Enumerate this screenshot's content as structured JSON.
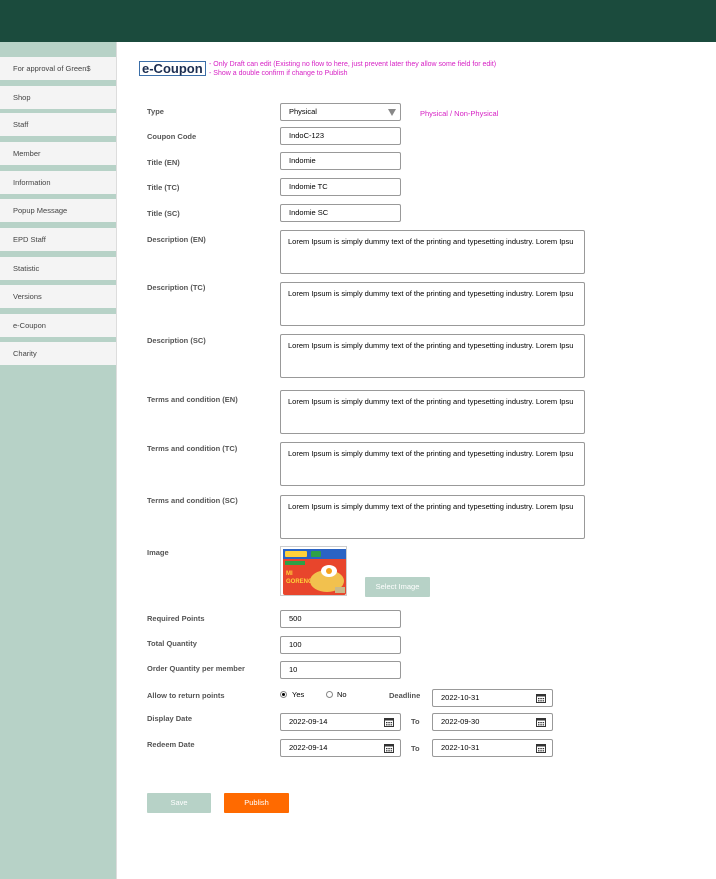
{
  "sidebar": {
    "items": [
      {
        "label": "For approval of Green$"
      },
      {
        "label": "Shop"
      },
      {
        "label": "Staff"
      },
      {
        "label": "Member"
      },
      {
        "label": "Information"
      },
      {
        "label": "Popup Message"
      },
      {
        "label": "EPD Staff"
      },
      {
        "label": "Statistic"
      },
      {
        "label": "Versions"
      },
      {
        "label": "e-Coupon"
      },
      {
        "label": "Charity"
      }
    ]
  },
  "page": {
    "title": "e-Coupon",
    "note_1": "- Only Draft can edit (Existing no flow to here, just prevent later they allow some field for edit)",
    "note_2": "- Show a double confirm if change to Publish"
  },
  "form": {
    "type": {
      "label": "Type",
      "value": "Physical",
      "hint": "Physical / Non-Physical"
    },
    "coupon_code": {
      "label": "Coupon Code",
      "value": "IndoC-123"
    },
    "title_en": {
      "label": "Title (EN)",
      "value": "Indomie"
    },
    "title_tc": {
      "label": "Title (TC)",
      "value": "Indomie TC"
    },
    "title_sc": {
      "label": "Title (SC)",
      "value": "Indomie SC"
    },
    "desc_en": {
      "label": "Description (EN)",
      "value": "Lorem Ipsum is simply dummy text of the printing and typesetting industry. Lorem Ipsu"
    },
    "desc_tc": {
      "label": "Description (TC)",
      "value": "Lorem Ipsum is simply dummy text of the printing and typesetting industry. Lorem Ipsu"
    },
    "desc_sc": {
      "label": "Description (SC)",
      "value": "Lorem Ipsum is simply dummy text of the printing and typesetting industry. Lorem Ipsu"
    },
    "terms_en": {
      "label": "Terms and condition (EN)",
      "value": "Lorem Ipsum is simply dummy text of the printing and typesetting industry. Lorem Ipsu"
    },
    "terms_tc": {
      "label": "Terms and condition (TC)",
      "value": "Lorem Ipsum is simply dummy text of the printing and typesetting industry. Lorem Ipsu"
    },
    "terms_sc": {
      "label": "Terms and condition (SC)",
      "value": "Lorem Ipsum is simply dummy text of the printing and typesetting industry. Lorem Ipsu"
    },
    "image": {
      "label": "Image",
      "select_label": "Select Image"
    },
    "required_points": {
      "label": "Required Points",
      "value": "500"
    },
    "total_quantity": {
      "label": "Total Quantity",
      "value": "100"
    },
    "order_qty": {
      "label": "Order Quantity per member",
      "value": "10"
    },
    "allow_return": {
      "label": "Allow to return points",
      "yes_label": "Yes",
      "no_label": "No",
      "selected": "Yes",
      "deadline_label": "Deadline",
      "deadline_value": "2022-10-31"
    },
    "display_date": {
      "label": "Display Date",
      "from": "2022-09-14",
      "to_label": "To",
      "to": "2022-09-30"
    },
    "redeem_date": {
      "label": "Redeem Date",
      "from": "2022-09-14",
      "to_label": "To",
      "to": "2022-10-31"
    }
  },
  "buttons": {
    "save_label": "Save",
    "publish_label": "Publish"
  },
  "colors": {
    "topbar": "#1b4b3d",
    "sidebar": "#b7d2c7",
    "note": "#d61fc4",
    "publish": "#ff6a00",
    "save": "#b7d2c7"
  }
}
